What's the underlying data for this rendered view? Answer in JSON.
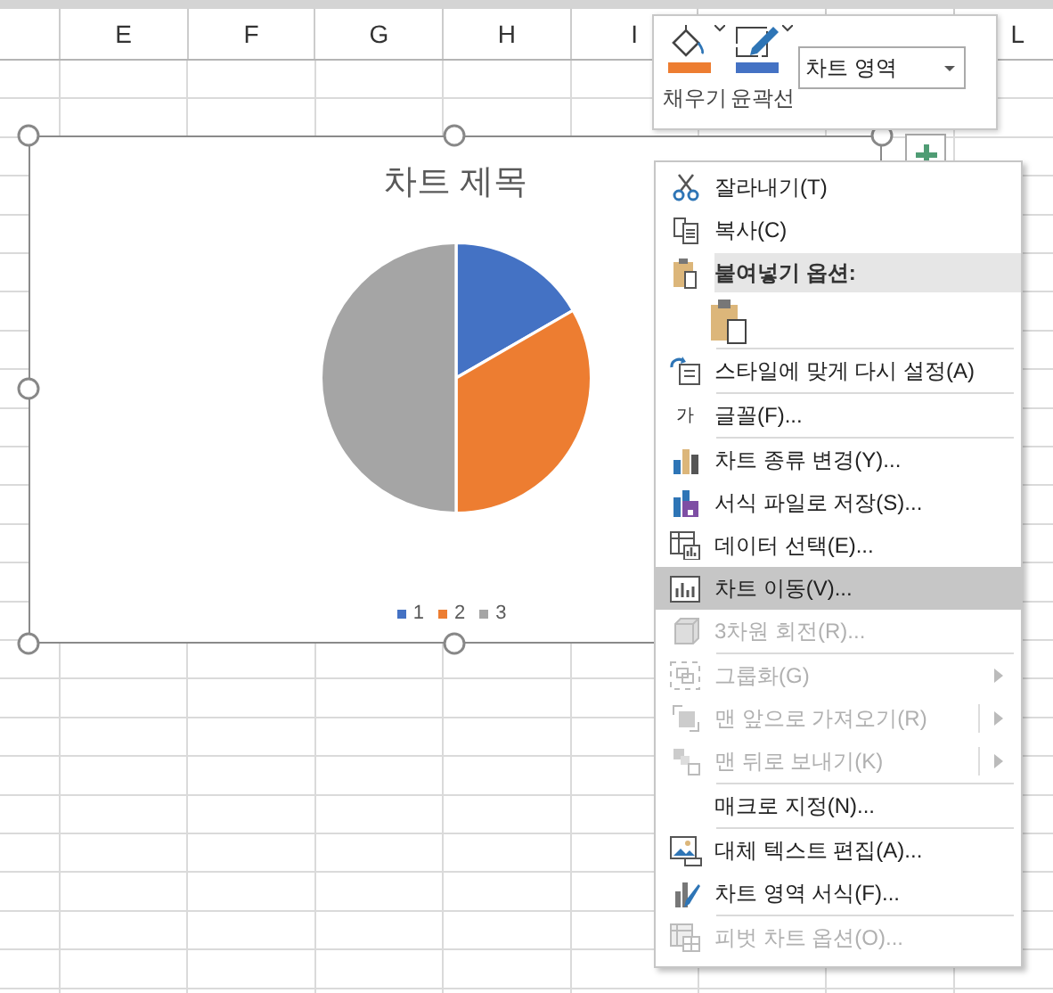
{
  "columns": [
    {
      "label": "E"
    },
    {
      "label": "F"
    },
    {
      "label": "G"
    },
    {
      "label": "H"
    },
    {
      "label": "I"
    },
    {
      "label": "L"
    }
  ],
  "chart": {
    "title": "차트 제목",
    "legend": [
      {
        "label": "1",
        "color": "#4472c4"
      },
      {
        "label": "2",
        "color": "#ed7d31"
      },
      {
        "label": "3",
        "color": "#a5a5a5"
      }
    ]
  },
  "mini_toolbar": {
    "buttons": [
      {
        "label": "채우기"
      },
      {
        "label": "윤곽선"
      }
    ],
    "dropdown": {
      "value": "차트 영역"
    }
  },
  "context_menu": {
    "items": [
      {
        "kind": "command",
        "label": "잘라내기(T)",
        "disabled": false,
        "selected": false,
        "submenu": false,
        "split": false
      },
      {
        "kind": "command",
        "label": "복사(C)",
        "disabled": false,
        "selected": false,
        "submenu": false,
        "split": false
      },
      {
        "kind": "header",
        "label": "붙여넣기 옵션:"
      },
      {
        "kind": "paste"
      },
      {
        "kind": "separator"
      },
      {
        "kind": "command",
        "label": "스타일에 맞게 다시 설정(A)",
        "disabled": false,
        "selected": false,
        "submenu": false,
        "split": false
      },
      {
        "kind": "separator"
      },
      {
        "kind": "command",
        "label": "글꼴(F)...",
        "icon_text": "가",
        "disabled": false,
        "selected": false,
        "submenu": false,
        "split": false
      },
      {
        "kind": "separator"
      },
      {
        "kind": "command",
        "label": "차트 종류 변경(Y)...",
        "disabled": false,
        "selected": false,
        "submenu": false,
        "split": false
      },
      {
        "kind": "command",
        "label": "서식 파일로 저장(S)...",
        "disabled": false,
        "selected": false,
        "submenu": false,
        "split": false
      },
      {
        "kind": "command",
        "label": "데이터 선택(E)...",
        "disabled": false,
        "selected": false,
        "submenu": false,
        "split": false
      },
      {
        "kind": "command",
        "label": "차트 이동(V)...",
        "disabled": false,
        "selected": true,
        "submenu": false,
        "split": false
      },
      {
        "kind": "command",
        "label": "3차원 회전(R)...",
        "disabled": true,
        "selected": false,
        "submenu": false,
        "split": false
      },
      {
        "kind": "separator"
      },
      {
        "kind": "command",
        "label": "그룹화(G)",
        "disabled": true,
        "selected": false,
        "submenu": true,
        "split": false
      },
      {
        "kind": "command",
        "label": "맨 앞으로 가져오기(R)",
        "disabled": true,
        "selected": false,
        "submenu": true,
        "split": true
      },
      {
        "kind": "command",
        "label": "맨 뒤로 보내기(K)",
        "disabled": true,
        "selected": false,
        "submenu": true,
        "split": true
      },
      {
        "kind": "separator"
      },
      {
        "kind": "command",
        "label": "매크로 지정(N)...",
        "disabled": false,
        "selected": false,
        "submenu": false,
        "split": false
      },
      {
        "kind": "separator"
      },
      {
        "kind": "command",
        "label": "대체 텍스트 편집(A)...",
        "disabled": false,
        "selected": false,
        "submenu": false,
        "split": false
      },
      {
        "kind": "command",
        "label": "차트 영역 서식(F)...",
        "disabled": false,
        "selected": false,
        "submenu": false,
        "split": false
      },
      {
        "kind": "separator"
      },
      {
        "kind": "command",
        "label": "피벗 차트 옵션(O)...",
        "disabled": true,
        "selected": false,
        "submenu": false,
        "split": false
      }
    ]
  }
}
